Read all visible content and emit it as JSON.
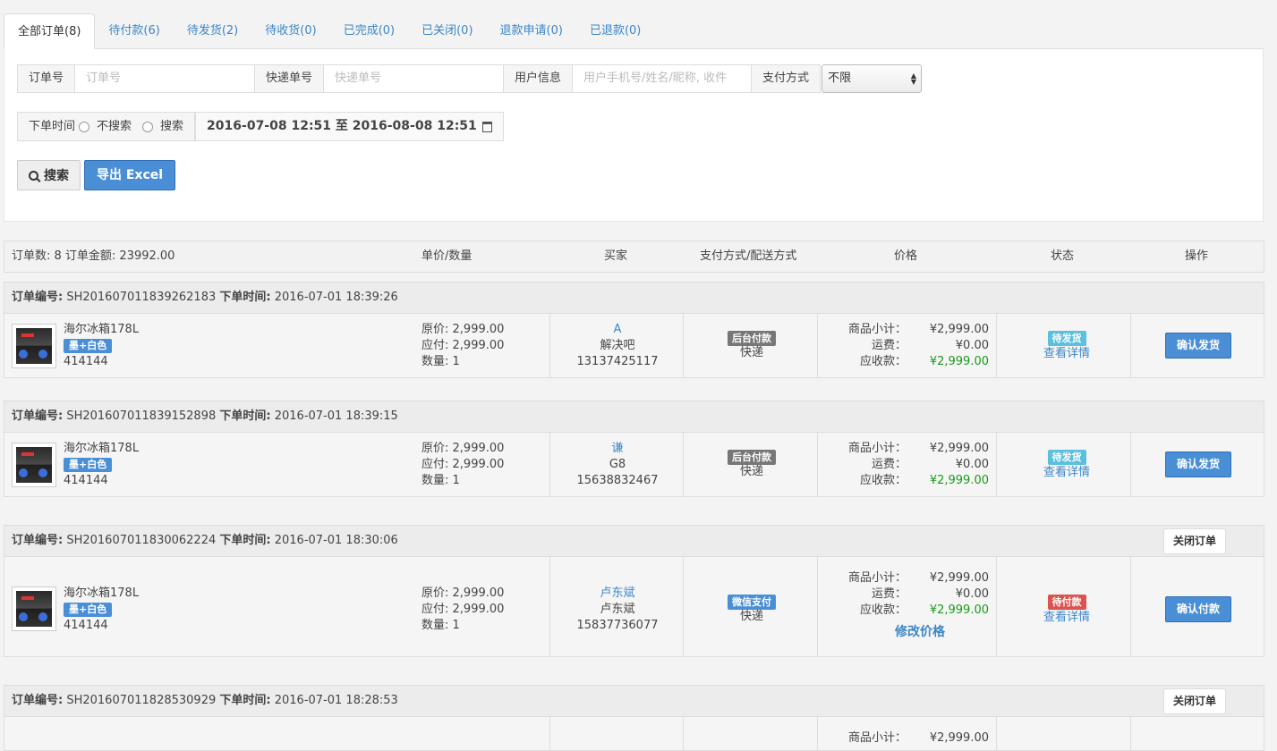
{
  "tabs": [
    {
      "label": "全部订单(8)",
      "active": true
    },
    {
      "label": "待付款(6)"
    },
    {
      "label": "待发货(2)"
    },
    {
      "label": "待收货(0)"
    },
    {
      "label": "已完成(0)"
    },
    {
      "label": "已关闭(0)"
    },
    {
      "label": "退款申请(0)"
    },
    {
      "label": "已退款(0)"
    }
  ],
  "filters": {
    "order_no_label": "订单号",
    "order_no_placeholder": "订单号",
    "express_label": "快递单号",
    "express_placeholder": "快递单号",
    "user_label": "用户信息",
    "user_placeholder": "用户手机号/姓名/昵称, 收件",
    "pay_label": "支付方式",
    "pay_value": "不限",
    "time_label": "下单时间",
    "radio_no": "不搜索",
    "radio_yes": "搜索",
    "date_range": "2016-07-08 12:51 至 2016-08-08 12:51",
    "search_btn": "搜索",
    "export_btn": "导出 Excel"
  },
  "table_header": {
    "summary": "订单数: 8 订单金额: 23992.00",
    "unit_qty": "单价/数量",
    "buyer": "买家",
    "pay_ship": "支付方式/配送方式",
    "price": "价格",
    "status": "状态",
    "ops": "操作"
  },
  "labels": {
    "order_no": "订单编号:",
    "order_time": "下单时间:",
    "orig": "原价: ",
    "payable": "应付: ",
    "qty": "数量: ",
    "subtotal": "商品小计：",
    "freight": "运费：",
    "receivable": "应收款：",
    "detail": "查看详情",
    "modify": "修改价格",
    "close": "关闭订单"
  },
  "orders": [
    {
      "no": "SH201607011839262183",
      "time": "2016-07-01 18:39:26",
      "product": "海尔冰箱178L",
      "spec": "墨+白色",
      "sku": "414144",
      "orig": "2,999.00",
      "payable": "2,999.00",
      "qty": "1",
      "buyer_nick": "A",
      "buyer_name": "解决吧",
      "buyer_phone": "13137425117",
      "pay_badge": "后台付款",
      "ship": "快递",
      "subtotal": "¥2,999.00",
      "freight": "¥0.00",
      "receivable": "¥2,999.00",
      "status": "待发货",
      "action": "确认发货"
    },
    {
      "no": "SH201607011839152898",
      "time": "2016-07-01 18:39:15",
      "product": "海尔冰箱178L",
      "spec": "墨+白色",
      "sku": "414144",
      "orig": "2,999.00",
      "payable": "2,999.00",
      "qty": "1",
      "buyer_nick": "谦",
      "buyer_name": "G8",
      "buyer_phone": "15638832467",
      "pay_badge": "后台付款",
      "ship": "快递",
      "subtotal": "¥2,999.00",
      "freight": "¥0.00",
      "receivable": "¥2,999.00",
      "status": "待发货",
      "action": "确认发货"
    },
    {
      "no": "SH201607011830062224",
      "time": "2016-07-01 18:30:06",
      "product": "海尔冰箱178L",
      "spec": "墨+白色",
      "sku": "414144",
      "orig": "2,999.00",
      "payable": "2,999.00",
      "qty": "1",
      "buyer_nick": "卢东斌",
      "buyer_name": "卢东斌",
      "buyer_phone": "15837736077",
      "pay_badge": "微信支付",
      "ship": "快递",
      "subtotal": "¥2,999.00",
      "freight": "¥0.00",
      "receivable": "¥2,999.00",
      "status": "待付款",
      "action": "确认付款"
    },
    {
      "no": "SH201607011828530929",
      "time": "2016-07-01 18:28:53",
      "subtotal": "¥2,999.00"
    }
  ]
}
